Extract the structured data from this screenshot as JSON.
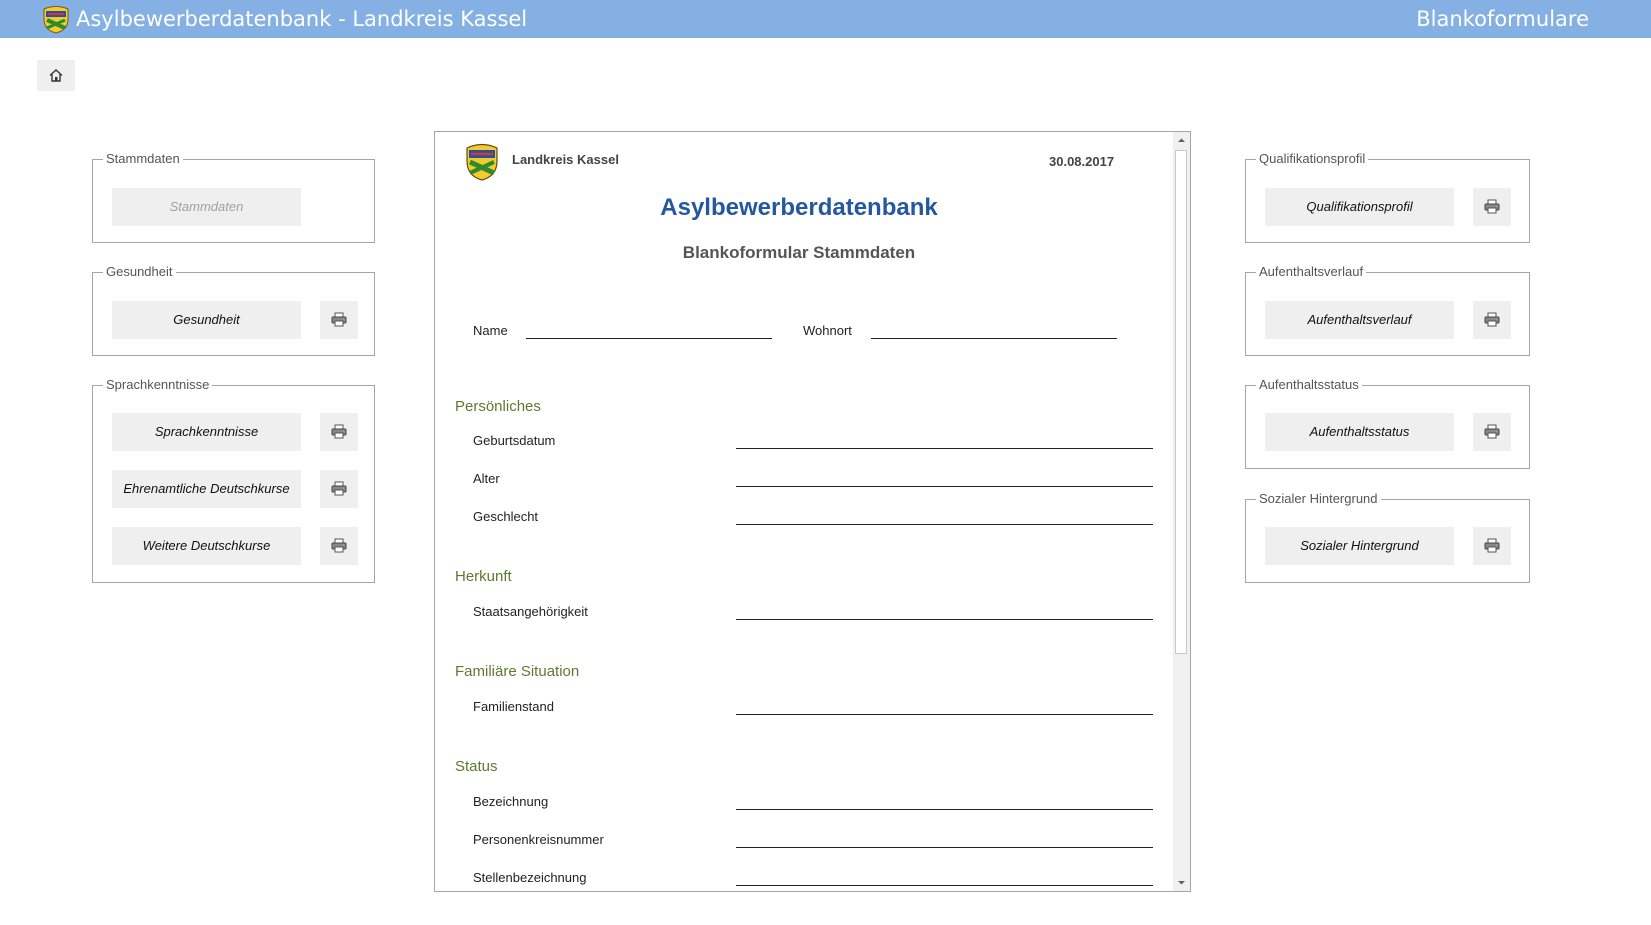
{
  "app": {
    "title": "Asylbewerberdatenbank - Landkreis Kassel",
    "section": "Blankoformulare"
  },
  "left_groups": [
    {
      "legend": "Stammdaten",
      "buttons": [
        {
          "label": "Stammdaten",
          "disabled": true
        }
      ]
    },
    {
      "legend": "Gesundheit",
      "buttons": [
        {
          "label": "Gesundheit"
        }
      ]
    },
    {
      "legend": "Sprachkenntnisse",
      "buttons": [
        {
          "label": "Sprachkenntnisse"
        },
        {
          "label": "Ehrenamtliche Deutschkurse"
        },
        {
          "label": "Weitere Deutschkurse"
        }
      ]
    }
  ],
  "right_groups": [
    {
      "legend": "Qualifikationsprofil",
      "buttons": [
        {
          "label": "Qualifikationsprofil"
        }
      ]
    },
    {
      "legend": "Aufenthaltsverlauf",
      "buttons": [
        {
          "label": "Aufenthaltsverlauf"
        }
      ]
    },
    {
      "legend": "Aufenthaltsstatus",
      "buttons": [
        {
          "label": "Aufenthaltsstatus"
        }
      ]
    },
    {
      "legend": "Sozialer Hintergrund",
      "buttons": [
        {
          "label": "Sozialer Hintergrund"
        }
      ]
    }
  ],
  "preview": {
    "org": "Landkreis Kassel",
    "date": "30.08.2017",
    "title": "Asylbewerberdatenbank",
    "subtitle": "Blankoformular Stammdaten",
    "name_label": "Name",
    "wohnort_label": "Wohnort",
    "sections": [
      {
        "title": "Persönliches",
        "fields": [
          "Geburtsdatum",
          "Alter",
          "Geschlecht"
        ]
      },
      {
        "title": "Herkunft",
        "fields": [
          "Staatsangehörigkeit"
        ]
      },
      {
        "title": "Familiäre Situation",
        "fields": [
          "Familienstand"
        ]
      },
      {
        "title": "Status",
        "fields": [
          "Bezeichnung",
          "Personenkreisnummer",
          "Stellenbezeichnung"
        ]
      }
    ]
  },
  "colors": {
    "titlebar": "#84b0e3",
    "doc_title": "#2458a0",
    "section_heading": "#5e7a2e",
    "button_bg": "#efefef"
  },
  "icons": {
    "home": "home-icon",
    "print": "printer-icon",
    "crest": "coat-of-arms-icon"
  }
}
